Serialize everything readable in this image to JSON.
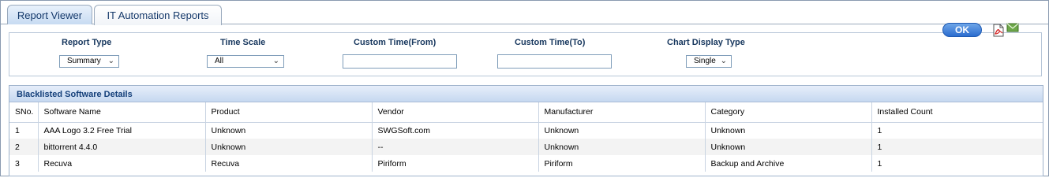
{
  "tabs": [
    {
      "label": "Report Viewer",
      "active": true
    },
    {
      "label": "IT Automation Reports",
      "active": false
    }
  ],
  "filters": {
    "report_type": {
      "label": "Report Type",
      "value": "Summary"
    },
    "time_scale": {
      "label": "Time Scale",
      "value": "All"
    },
    "custom_from": {
      "label": "Custom Time(From)",
      "value": ""
    },
    "custom_to": {
      "label": "Custom Time(To)",
      "value": ""
    },
    "chart_display_type": {
      "label": "Chart Display Type",
      "value": "Single"
    },
    "ok_label": "OK",
    "pdf_icon": "pdf-export-icon",
    "mail_icon": "email-icon"
  },
  "grid": {
    "title": "Blacklisted Software Details",
    "columns": [
      "SNo.",
      "Software Name",
      "Product",
      "Vendor",
      "Manufacturer",
      "Category",
      "Installed Count"
    ],
    "rows": [
      [
        "1",
        "AAA Logo 3.2 Free Trial",
        "Unknown",
        "SWGSoft.com",
        "Unknown",
        "Unknown",
        "1"
      ],
      [
        "2",
        "bittorrent 4.4.0",
        "Unknown",
        "--",
        "Unknown",
        "Unknown",
        "1"
      ],
      [
        "3",
        "Recuva",
        "Recuva",
        "Piriform",
        "Piriform",
        "Backup and Archive",
        "1"
      ]
    ]
  },
  "colors": {
    "accent": "#2b6ccf",
    "header_text": "#17375e"
  }
}
